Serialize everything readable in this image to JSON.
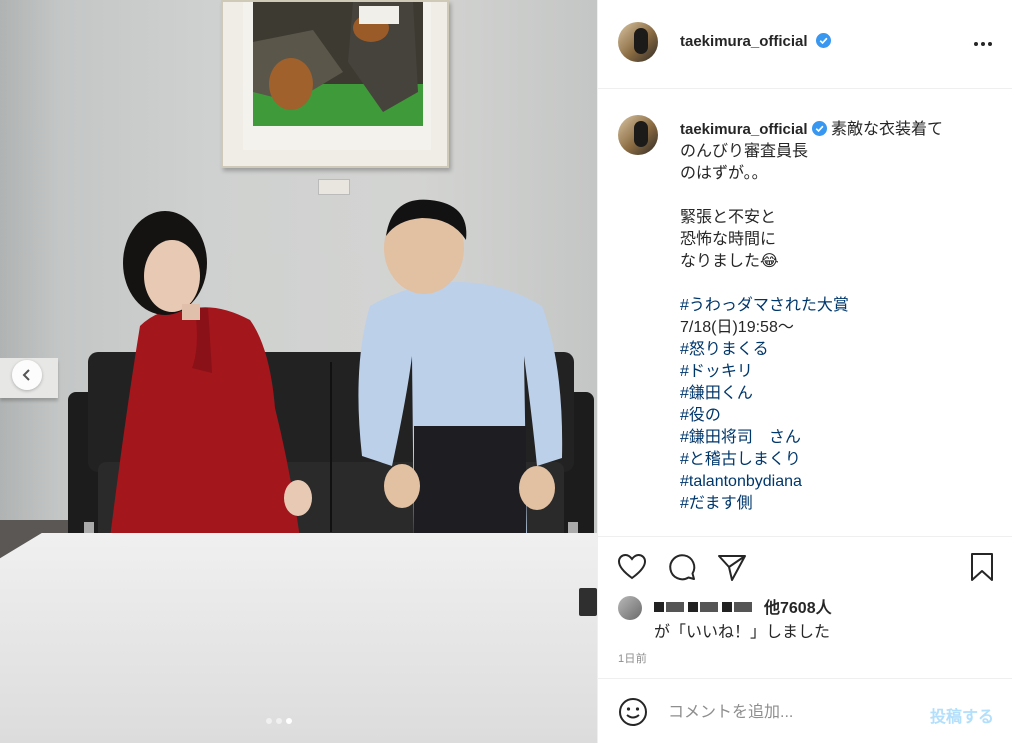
{
  "post": {
    "username": "taekimura_official",
    "verified_icon": "verified-badge-icon",
    "caption_lines": [
      "素敵な衣装着て",
      "のんびり審査員長",
      "のはずが。。"
    ],
    "caption_lines_2": [
      "緊張と不安と",
      "恐怖な時間に",
      "なりました😂"
    ],
    "hashtag_1": "#うわっダマされた大賞",
    "airtime": "7/18(日)19:58〜",
    "hashtags_2": [
      "#怒りまくる",
      "#ドッキリ",
      "#鎌田くん",
      "#役の",
      "#鎌田将司　さん",
      "#と稽古しまくり",
      "#talantonbydiana",
      "#だます側"
    ]
  },
  "likes": {
    "count": "他7608人",
    "suffix": "が「いいね！」しました"
  },
  "timestamp": "1日前",
  "comment": {
    "placeholder": "コメントを追加...",
    "post_label": "投稿する"
  },
  "colors": {
    "hashtag": "#00376b",
    "verified": "#3897f0",
    "post_button_disabled": "#b2dffc",
    "dress_red": "#a3161c",
    "shirt_blue": "#bcd0ea"
  },
  "carousel": {
    "slides": 3,
    "active": 3
  }
}
